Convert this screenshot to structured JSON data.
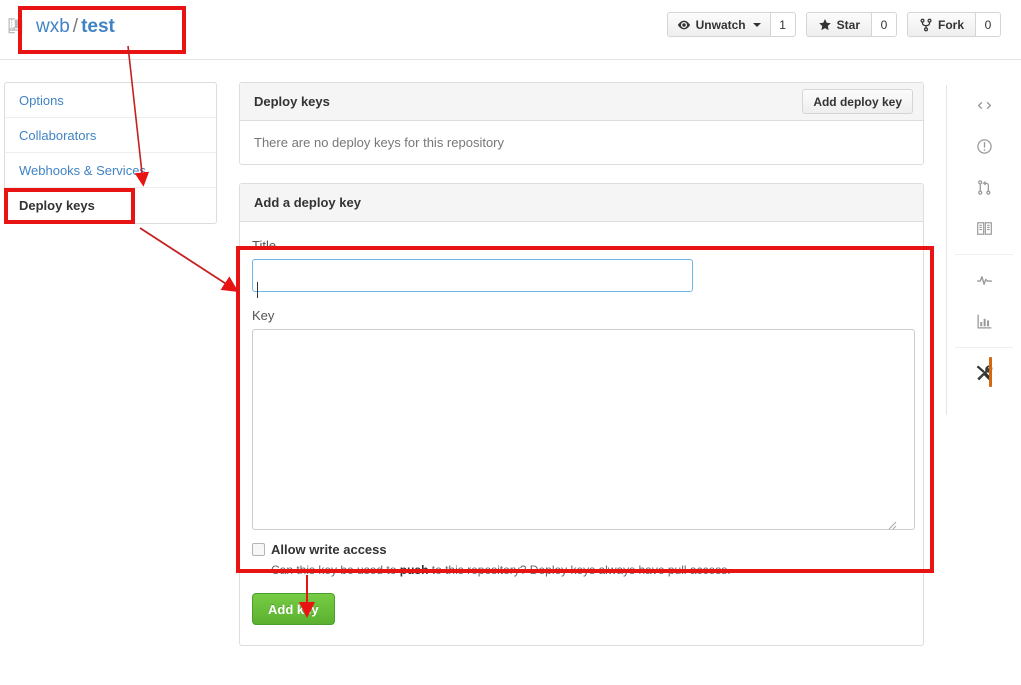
{
  "header": {
    "repo_owner": "wxb",
    "separator": "/",
    "repo_name": "test",
    "repo_icon": "repo-icon",
    "actions": [
      {
        "icon": "eye-icon",
        "label": "Unwatch",
        "count": "1",
        "has_caret": true
      },
      {
        "icon": "star-icon",
        "label": "Star",
        "count": "0",
        "has_caret": false
      },
      {
        "icon": "fork-icon",
        "label": "Fork",
        "count": "0",
        "has_caret": false
      }
    ]
  },
  "sidebar": {
    "items": [
      {
        "label": "Options",
        "active": false
      },
      {
        "label": "Collaborators",
        "active": false
      },
      {
        "label": "Webhooks & Services",
        "active": false
      },
      {
        "label": "Deploy keys",
        "active": true
      }
    ]
  },
  "deploy_keys_panel": {
    "title": "Deploy keys",
    "add_button": "Add deploy key",
    "empty_message": "There are no deploy keys for this repository"
  },
  "form_panel": {
    "title": "Add a deploy key",
    "title_label": "Title",
    "title_value": "",
    "title_placeholder": "",
    "key_label": "Key",
    "key_value": "",
    "key_placeholder": "",
    "checkbox_label": "Allow write access",
    "checkbox_checked": false,
    "help_prefix": "Can this key be used to ",
    "help_bold": "push",
    "help_suffix": " to this repository? Deploy keys always have pull access.",
    "submit_label": "Add key"
  },
  "rail": {
    "items": [
      {
        "name": "code-icon",
        "active": false
      },
      {
        "name": "issues-icon",
        "active": false
      },
      {
        "name": "pull-request-icon",
        "active": false
      },
      {
        "name": "wiki-book-icon",
        "active": false
      },
      {
        "name": "pulse-icon",
        "active": false
      },
      {
        "name": "graphs-icon",
        "active": false
      },
      {
        "name": "settings-tools-icon",
        "active": true
      }
    ]
  },
  "colors": {
    "annotation": "#e81313",
    "link": "#4183c4",
    "focus_border": "#6cb6e8",
    "submit_green": "#5bb12f",
    "active_rail": "#d26911"
  }
}
